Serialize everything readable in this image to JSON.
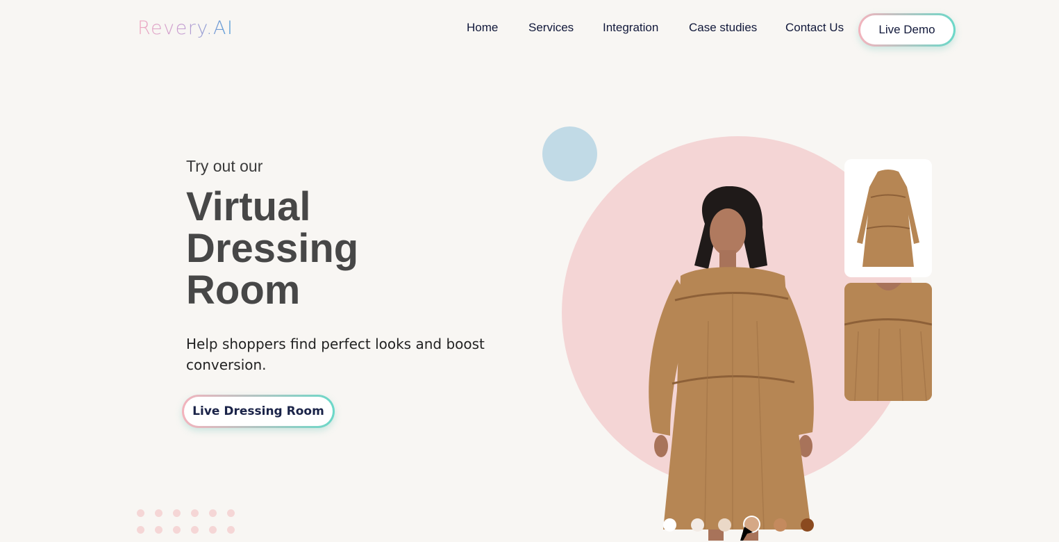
{
  "brand": {
    "logo_text": "Revery.AI"
  },
  "nav": {
    "items": [
      "Home",
      "Services",
      "Integration",
      "Case studies",
      "Contact Us"
    ],
    "cta_label": "Live Demo"
  },
  "hero": {
    "pre_title": "Try out our",
    "title_lines": [
      "Virtual",
      "Dressing",
      "Room"
    ],
    "subtitle": "Help shoppers find perfect looks and boost conversion.",
    "cta_label": "Live Dressing Room"
  },
  "visual": {
    "accent_circle_color": "#f4d5d5",
    "small_circle_color": "#c1dae6",
    "product_color": "#b68654",
    "swatches": [
      "#ffffff",
      "#f3ebe5",
      "#ead8c7",
      "#d5a886",
      "#c48a5e",
      "#8b4a1f"
    ],
    "selected_swatch_index": 3
  },
  "colors": {
    "nav_text": "#11183a",
    "title": "#474747",
    "background": "#f8f6f3"
  }
}
